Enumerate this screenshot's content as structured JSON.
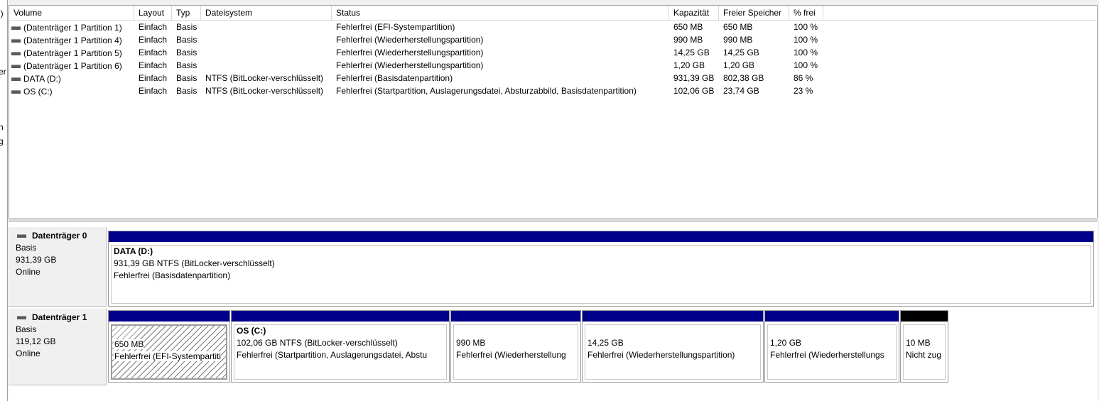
{
  "left_pane": {
    "fragments": [
      "l)",
      "er",
      "n",
      "g"
    ]
  },
  "volume_list": {
    "columns": [
      "Volume",
      "Layout",
      "Typ",
      "Dateisystem",
      "Status",
      "Kapazität",
      "Freier Speicher",
      "% frei"
    ],
    "rows": [
      {
        "volume": "(Datenträger 1 Partition 1)",
        "layout": "Einfach",
        "typ": "Basis",
        "fs": "",
        "status": "Fehlerfrei (EFI-Systempartition)",
        "kapazitaet": "650 MB",
        "frei": "650 MB",
        "prozent": "100 %"
      },
      {
        "volume": "(Datenträger 1 Partition 4)",
        "layout": "Einfach",
        "typ": "Basis",
        "fs": "",
        "status": "Fehlerfrei (Wiederherstellungspartition)",
        "kapazitaet": "990 MB",
        "frei": "990 MB",
        "prozent": "100 %"
      },
      {
        "volume": "(Datenträger 1 Partition 5)",
        "layout": "Einfach",
        "typ": "Basis",
        "fs": "",
        "status": "Fehlerfrei (Wiederherstellungspartition)",
        "kapazitaet": "14,25 GB",
        "frei": "14,25 GB",
        "prozent": "100 %"
      },
      {
        "volume": "(Datenträger 1 Partition 6)",
        "layout": "Einfach",
        "typ": "Basis",
        "fs": "",
        "status": "Fehlerfrei (Wiederherstellungspartition)",
        "kapazitaet": "1,20 GB",
        "frei": "1,20 GB",
        "prozent": "100 %"
      },
      {
        "volume": "DATA (D:)",
        "layout": "Einfach",
        "typ": "Basis",
        "fs": "NTFS (BitLocker-verschlüsselt)",
        "status": "Fehlerfrei (Basisdatenpartition)",
        "kapazitaet": "931,39 GB",
        "frei": "802,38 GB",
        "prozent": "86 %"
      },
      {
        "volume": "OS (C:)",
        "layout": "Einfach",
        "typ": "Basis",
        "fs": "NTFS (BitLocker-verschlüsselt)",
        "status": "Fehlerfrei (Startpartition, Auslagerungsdatei, Absturzabbild, Basisdatenpartition)",
        "kapazitaet": "102,06 GB",
        "frei": "23,74 GB",
        "prozent": "23 %"
      }
    ]
  },
  "disks": [
    {
      "title": "Datenträger 0",
      "type": "Basis",
      "size": "931,39 GB",
      "state": "Online",
      "partitions": [
        {
          "name": "DATA  (D:)",
          "line1": "931,39 GB NTFS (BitLocker-verschlüsselt)",
          "line2": "Fehlerfrei (Basisdatenpartition)"
        }
      ]
    },
    {
      "title": "Datenträger 1",
      "type": "Basis",
      "size": "119,12 GB",
      "state": "Online",
      "partitions": [
        {
          "name": "",
          "line1": "650 MB",
          "line2": "Fehlerfrei (EFI-Systempartiti"
        },
        {
          "name": "OS  (C:)",
          "line1": "102,06 GB NTFS (BitLocker-verschlüsselt)",
          "line2": "Fehlerfrei (Startpartition, Auslagerungsdatei, Abstu"
        },
        {
          "name": "",
          "line1": "990 MB",
          "line2": "Fehlerfrei (Wiederherstellung"
        },
        {
          "name": "",
          "line1": "14,25 GB",
          "line2": "Fehlerfrei (Wiederherstellungspartition)"
        },
        {
          "name": "",
          "line1": "1,20 GB",
          "line2": "Fehlerfrei (Wiederherstellungs"
        },
        {
          "name": "",
          "line1": "10 MB",
          "line2": "Nicht zug"
        }
      ]
    }
  ],
  "colors": {
    "primary_bar": "#00008b",
    "unallocated_bar": "#000000"
  }
}
